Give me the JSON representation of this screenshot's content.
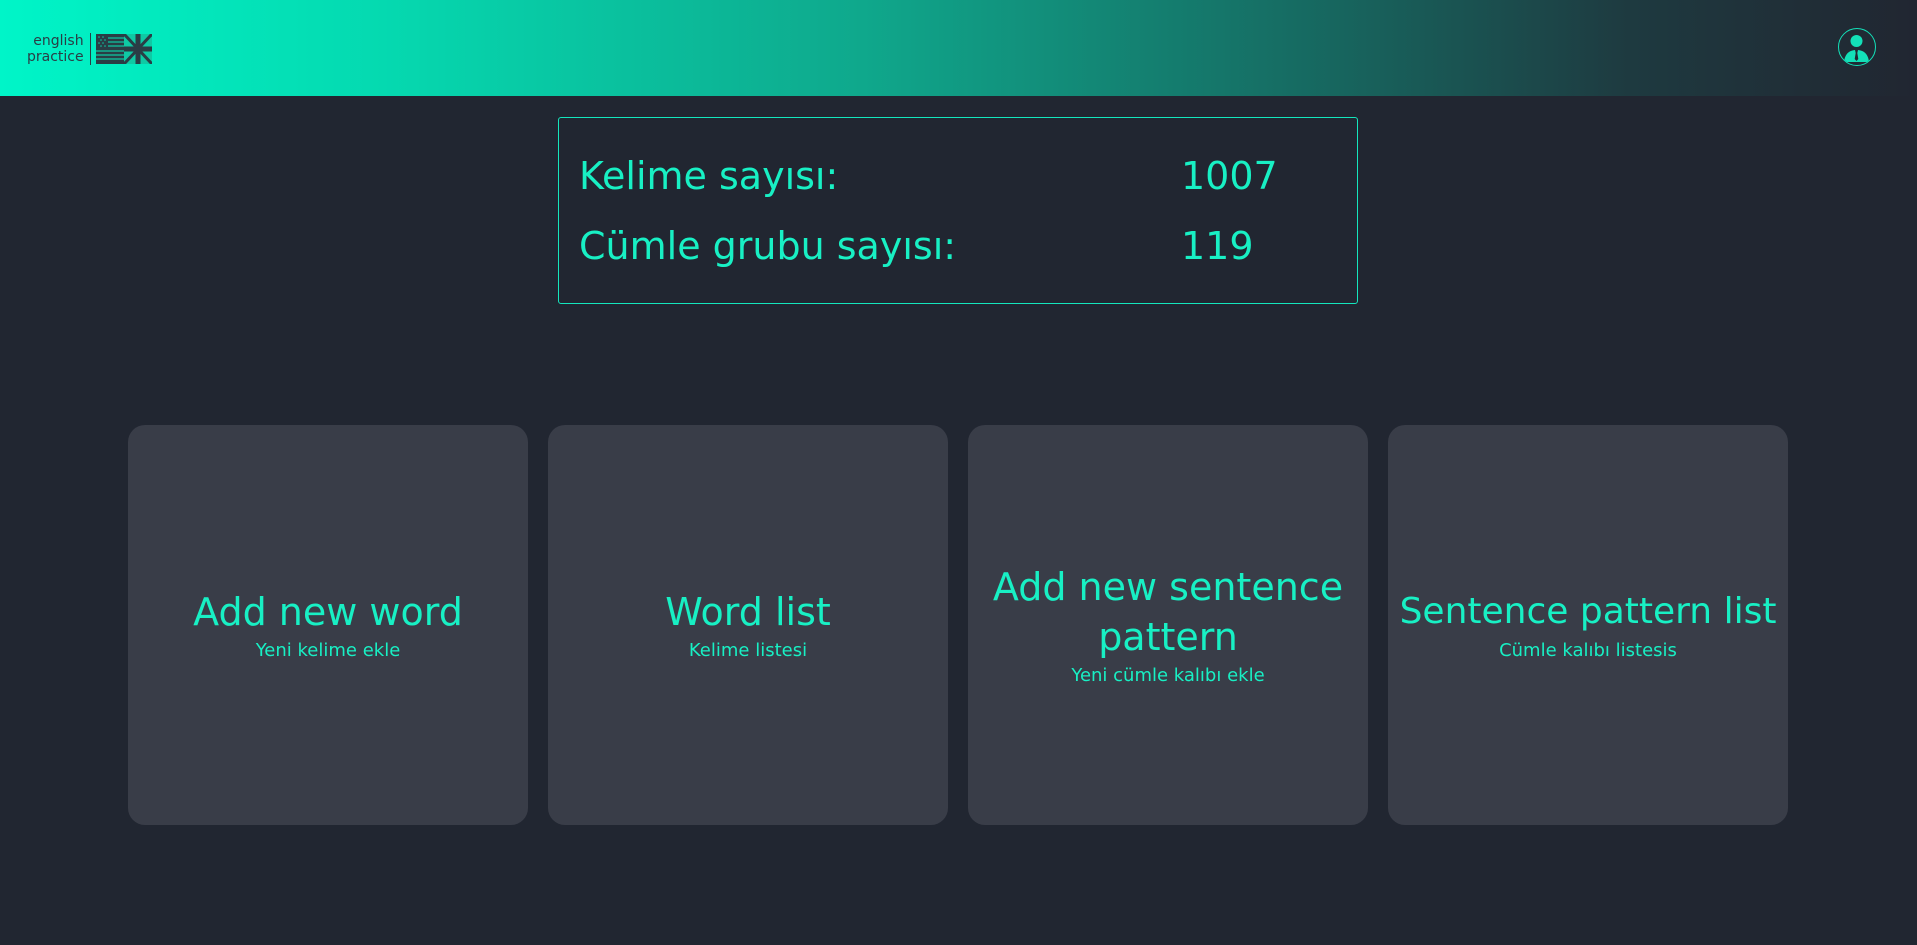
{
  "header": {
    "logo_line1": "english",
    "logo_line2": "practice",
    "gradient_start": "#00f5c8",
    "gradient_end": "#212631"
  },
  "stats": {
    "word_count_label": "Kelime sayısı:",
    "word_count_value": "1007",
    "sentence_group_label": "Cümle grubu sayısı:",
    "sentence_group_value": "119"
  },
  "cards": [
    {
      "title": "Add new word",
      "subtitle": "Yeni kelime ekle"
    },
    {
      "title": "Word list",
      "subtitle": "Kelime listesi"
    },
    {
      "title": "Add new sentence pattern",
      "subtitle": "Yeni cümle kalıbı ekle"
    },
    {
      "title": "Sentence pattern list",
      "subtitle": "Cümle kalıbı listesis"
    }
  ],
  "colors": {
    "accent": "#18f0c4",
    "background": "#212631",
    "card": "#393d48"
  },
  "icons": {
    "logo_flag": "us-uk-flag-icon",
    "account": "user-avatar-icon"
  }
}
